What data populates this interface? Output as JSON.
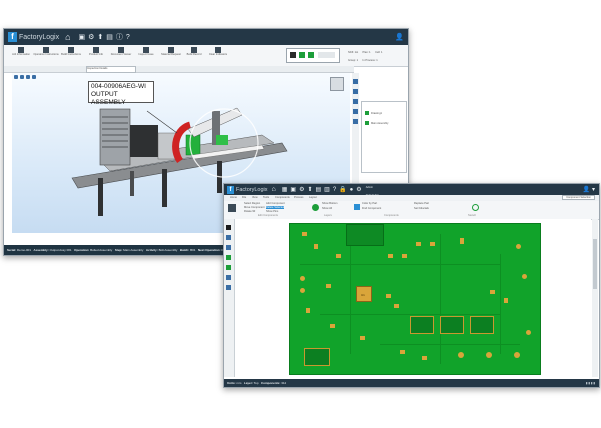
{
  "window1": {
    "brand": {
      "mark": "f",
      "name": "FactoryLogix"
    },
    "user_info": [
      "Shift: 1st",
      "Plan: 1",
      "Cell: 1",
      "Group: 1",
      "In Process: 1"
    ],
    "toolbar_labels": [
      "Job Information",
      "Operation Instructions",
      "Build Instructions",
      "Product Info",
      "Document Viewer",
      "Inspect Issue",
      "Material Request",
      "Build Record",
      "Clear Indicators"
    ],
    "doc_tab": "Inspection Details",
    "callout": [
      "004-00906AEG-WI",
      "OUTPUT ASSEMBLY"
    ],
    "right_panel": [
      "Drawing1",
      "Main Assembly"
    ],
    "status": [
      {
        "label": "Serial:",
        "value": "Demo-001"
      },
      {
        "label": "Assembly:",
        "value": "Output Assy 001"
      },
      {
        "label": "Operation:",
        "value": "Bolted Assembly"
      },
      {
        "label": "Step:",
        "value": "Main Assembly"
      },
      {
        "label": "Activity:",
        "value": "Bolt Assembly"
      },
      {
        "label": "Batch:",
        "value": "B01"
      },
      {
        "label": "Next Operation:",
        "value": "Final"
      },
      {
        "label": "Current Step:",
        "value": "1"
      }
    ]
  },
  "window2": {
    "brand": {
      "mark": "f",
      "name": "FactoryLogix"
    },
    "user_info": [
      "Admin",
      "Default Site"
    ],
    "menu_tabs": [
      "Home",
      "File",
      "View",
      "Tools",
      "Components",
      "Process",
      "Layout"
    ],
    "quick_find": "Component Selection",
    "ribbon_groups": [
      "Edit Components",
      "Layers",
      "Components",
      "Stencil"
    ],
    "ribbon_items": [
      "Select Region",
      "Move Component",
      "Rotate 90",
      "Add Component",
      "Delete Selected",
      "Show Pins",
      "Show Bottom",
      "Show All",
      "Color by Part",
      "Find Component",
      "Replace Part",
      "Set Fiducials"
    ],
    "chip_label": "U1",
    "status": [
      {
        "label": "Units:",
        "value": "mm"
      },
      {
        "label": "Layer:",
        "value": "Top"
      },
      {
        "label": "Components:",
        "value": "312"
      }
    ]
  },
  "colors": {
    "title_bar": "#243746",
    "pcb_green": "#11a32a",
    "pad_gold": "#d9a53a",
    "accent_blue": "#2a8fd4"
  }
}
